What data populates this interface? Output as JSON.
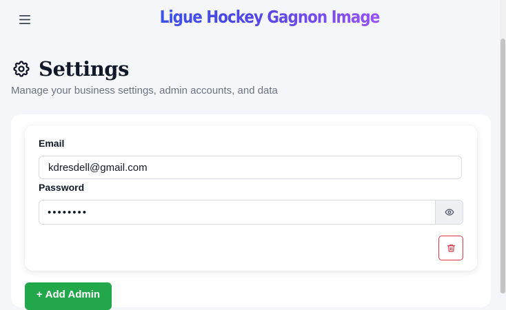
{
  "header": {
    "brand": "Ligue Hockey Gagnon Image",
    "menu_icon": "hamburger-menu-icon"
  },
  "page": {
    "title": "Settings",
    "title_icon": "gear-icon",
    "subtitle": "Manage your business settings, admin accounts, and data"
  },
  "admin": {
    "email_label": "Email",
    "email_value": "kdresdell@gmail.com",
    "password_label": "Password",
    "password_masked": "••••••••",
    "show_password_icon": "eye-icon",
    "delete_icon": "trash-icon"
  },
  "actions": {
    "add_admin_icon": "+",
    "add_admin_label": "Add Admin"
  },
  "colors": {
    "brand_gradient_start": "#2563eb",
    "brand_gradient_end": "#d946ef",
    "danger": "#dc3545",
    "success": "#22a84a",
    "background": "#f4f6f9"
  }
}
